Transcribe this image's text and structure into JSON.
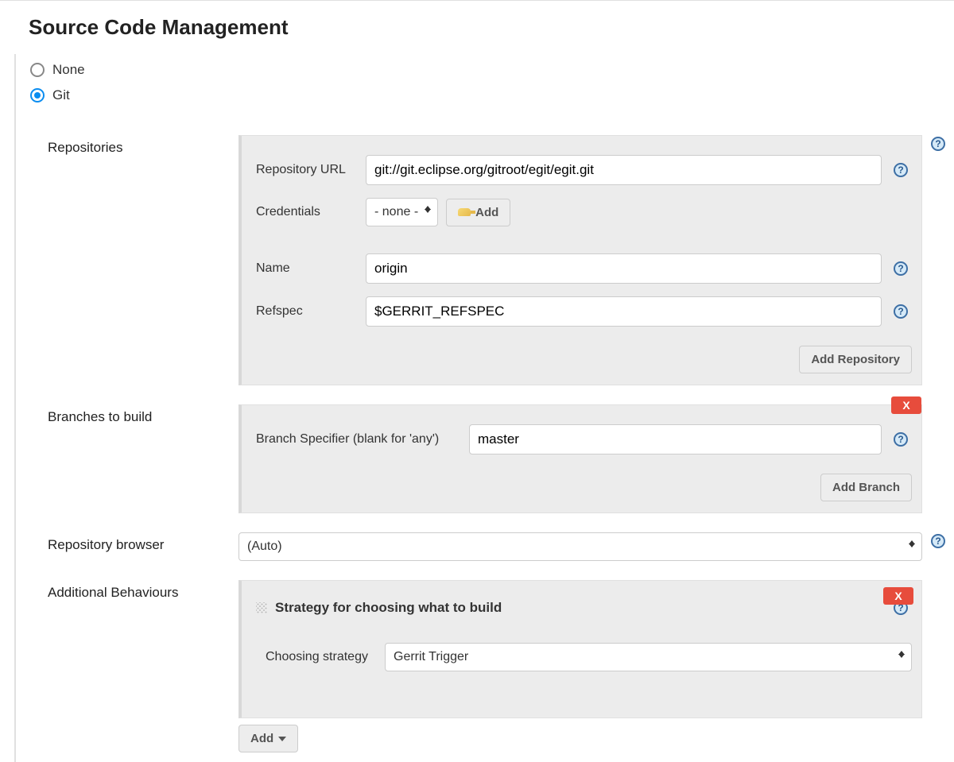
{
  "section_title": "Source Code Management",
  "scm_options": {
    "none_label": "None",
    "git_label": "Git",
    "selected": "git"
  },
  "repositories": {
    "label": "Repositories",
    "url_label": "Repository URL",
    "url_value": "git://git.eclipse.org/gitroot/egit/egit.git",
    "credentials_label": "Credentials",
    "credentials_selected": "- none -",
    "add_cred_label": "Add",
    "name_label": "Name",
    "name_value": "origin",
    "refspec_label": "Refspec",
    "refspec_value": "$GERRIT_REFSPEC",
    "add_repo_label": "Add Repository"
  },
  "branches": {
    "label": "Branches to build",
    "specifier_label": "Branch Specifier (blank for 'any')",
    "specifier_value": "master",
    "add_branch_label": "Add Branch",
    "delete_label": "X"
  },
  "repo_browser": {
    "label": "Repository browser",
    "selected": "(Auto)"
  },
  "behaviours": {
    "label": "Additional Behaviours",
    "strategy_title": "Strategy for choosing what to build",
    "strategy_label": "Choosing strategy",
    "strategy_selected": "Gerrit Trigger",
    "delete_label": "X",
    "add_label": "Add"
  }
}
